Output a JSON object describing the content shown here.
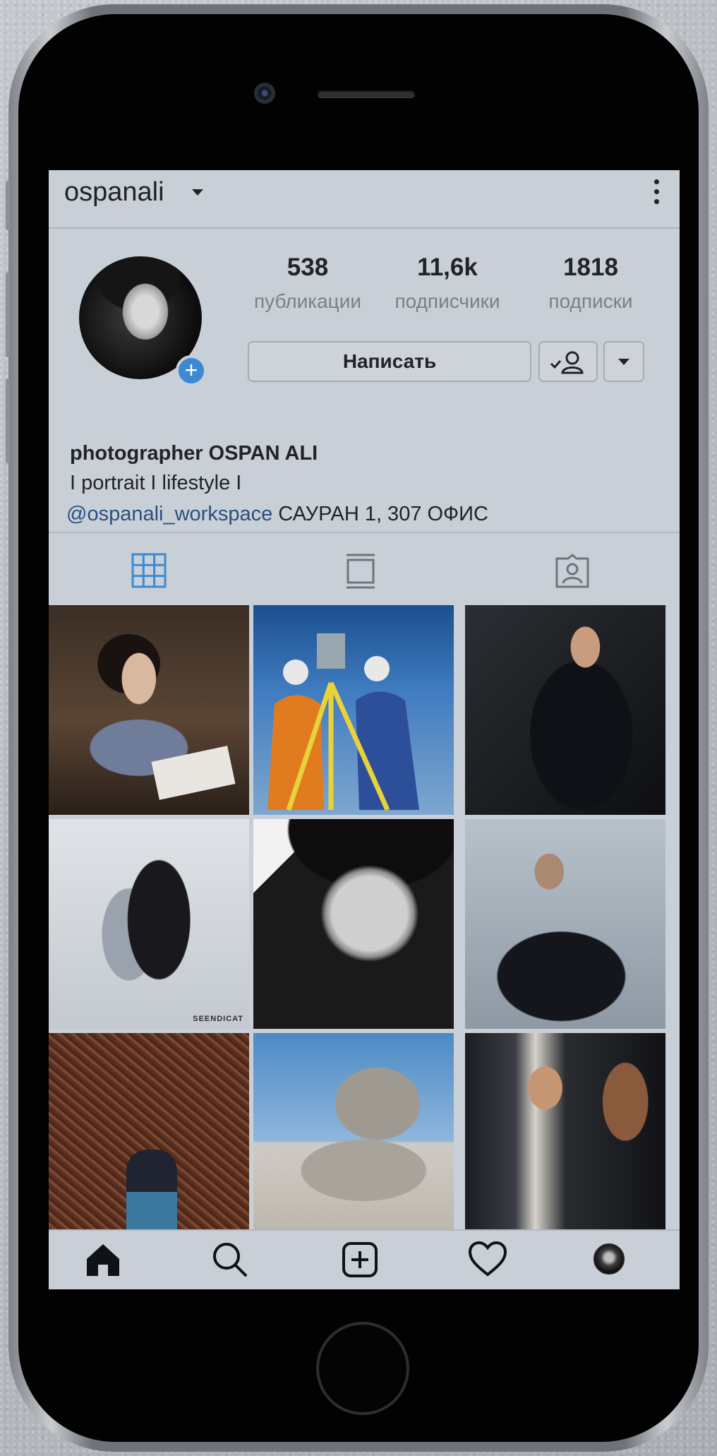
{
  "profile": {
    "username": "ospanali",
    "stats": [
      {
        "value": "538",
        "label": "публикации"
      },
      {
        "value": "11,6k",
        "label": "подписчики"
      },
      {
        "value": "1818",
        "label": "подписки"
      }
    ],
    "message_button": "Написать"
  },
  "bio": {
    "name": "photographer OSPAN ALI",
    "tagline": "I  portrait  I  lifestyle  I",
    "link": "@ospanali_workspace",
    "address": " САУРАН 1, 307 ОФИС"
  },
  "tabs": [
    "grid-icon",
    "feed-icon",
    "tagged-icon"
  ],
  "grid_photo_watermark": "SEENDICAT",
  "bottom_nav": [
    "home-icon",
    "search-icon",
    "add-post-icon",
    "heart-icon",
    "profile-avatar"
  ],
  "colors": {
    "accent": "#3d8ad3",
    "link": "#2c4f7e",
    "screen_bg": "#c9cfd6"
  }
}
